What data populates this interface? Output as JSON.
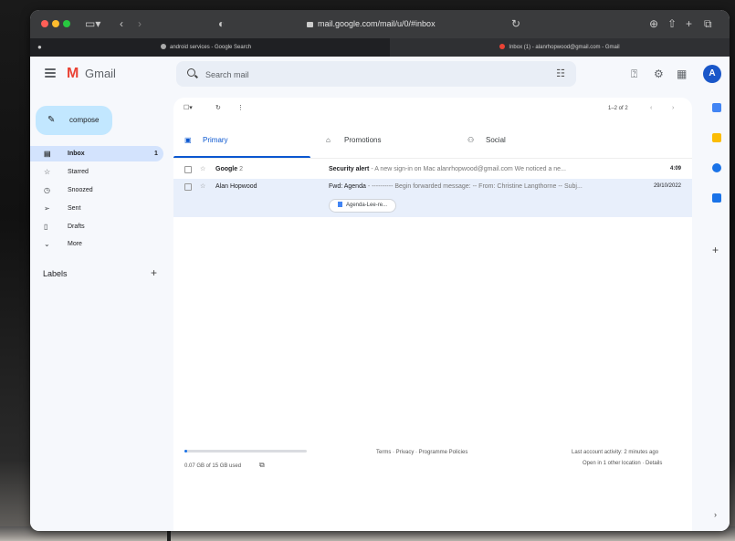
{
  "browser": {
    "url": "mail.google.com/mail/u/0/#inbox",
    "tabs": [
      {
        "label": "android services - Google Search"
      },
      {
        "label": "Inbox (1) - alanrhopwood@gmail.com - Gmail"
      }
    ]
  },
  "gmail": {
    "app_name": "Gmail",
    "search_placeholder": "Search mail",
    "avatar_initial": "A"
  },
  "sidebar": {
    "compose_label": "compose",
    "items": [
      {
        "label": "Inbox",
        "count": "1"
      },
      {
        "label": "Starred"
      },
      {
        "label": "Snoozed"
      },
      {
        "label": "Sent"
      },
      {
        "label": "Drafts"
      },
      {
        "label": "More"
      }
    ],
    "labels_heading": "Labels"
  },
  "toolbar": {
    "pagination": "1–2 of 2"
  },
  "tabs": [
    {
      "label": "Primary"
    },
    {
      "label": "Promotions"
    },
    {
      "label": "Social"
    }
  ],
  "emails": [
    {
      "from": "Google",
      "count": "2",
      "subject": "Security alert",
      "snippet": "- A new sign-in on Mac alanrhopwood@gmail.com We noticed a ne...",
      "date": "4:09"
    },
    {
      "from": "Alan Hopwood",
      "subject": "Fwd: Agenda",
      "snippet": "- ---------- Begin forwarded message: -- From: Christine Langthorne -- Subj...",
      "date": "29/10/2022",
      "attachment": "Agenda-Lee-re..."
    }
  ],
  "footer": {
    "storage": "0.07 GB of 15 GB used",
    "storage_fraction": 0.005,
    "links": "Terms · Privacy · Programme Policies",
    "activity": "Last account activity: 2 minutes ago",
    "details": "Open in 1 other location · Details"
  },
  "colors": {
    "gmail_red": "#ea4335",
    "compose_bg": "#c2e7ff",
    "active_nav": "#d3e3fd",
    "accent_blue": "#0b57d0"
  }
}
